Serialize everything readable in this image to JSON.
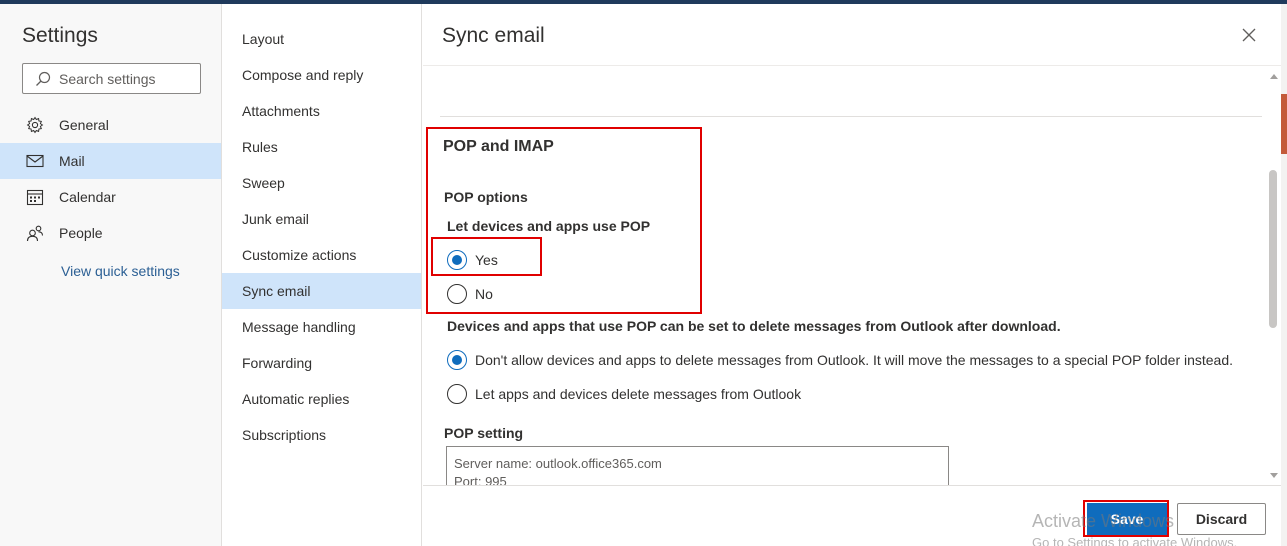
{
  "left_nav": {
    "title": "Settings",
    "search_placeholder": "Search settings",
    "items": [
      {
        "label": "General",
        "icon": "gear-icon",
        "active": false
      },
      {
        "label": "Mail",
        "icon": "mail-icon",
        "active": true
      },
      {
        "label": "Calendar",
        "icon": "calendar-icon",
        "active": false
      },
      {
        "label": "People",
        "icon": "people-icon",
        "active": false
      }
    ],
    "quick_settings_link": "View quick settings"
  },
  "mail_nav": {
    "items": [
      {
        "label": "Layout",
        "active": false
      },
      {
        "label": "Compose and reply",
        "active": false
      },
      {
        "label": "Attachments",
        "active": false
      },
      {
        "label": "Rules",
        "active": false
      },
      {
        "label": "Sweep",
        "active": false
      },
      {
        "label": "Junk email",
        "active": false
      },
      {
        "label": "Customize actions",
        "active": false
      },
      {
        "label": "Sync email",
        "active": true
      },
      {
        "label": "Message handling",
        "active": false
      },
      {
        "label": "Forwarding",
        "active": false
      },
      {
        "label": "Automatic replies",
        "active": false
      },
      {
        "label": "Subscriptions",
        "active": false
      }
    ]
  },
  "panel": {
    "title": "Sync email",
    "section_heading": "POP and IMAP",
    "pop_options_heading": "POP options",
    "use_pop_question": "Let devices and apps use POP",
    "use_pop_options": [
      {
        "label": "Yes",
        "checked": true
      },
      {
        "label": "No",
        "checked": false
      }
    ],
    "delete_question": "Devices and apps that use POP can be set to delete messages from Outlook after download.",
    "delete_options": [
      {
        "label": "Don't allow devices and apps to delete messages from Outlook. It will move the messages to a special POP folder instead.",
        "checked": true
      },
      {
        "label": "Let apps and devices delete messages from Outlook",
        "checked": false
      }
    ],
    "pop_setting_heading": "POP setting",
    "pop_setting_lines": [
      "Server name: outlook.office365.com",
      "Port: 995"
    ]
  },
  "footer": {
    "save_label": "Save",
    "discard_label": "Discard"
  },
  "watermark": {
    "line1": "Activate Windows",
    "line2": "Go to Settings to activate Windows."
  },
  "colors": {
    "accent": "#0f6cbd",
    "selected_bg": "#cfe4fa",
    "highlight_red": "#e00000"
  }
}
